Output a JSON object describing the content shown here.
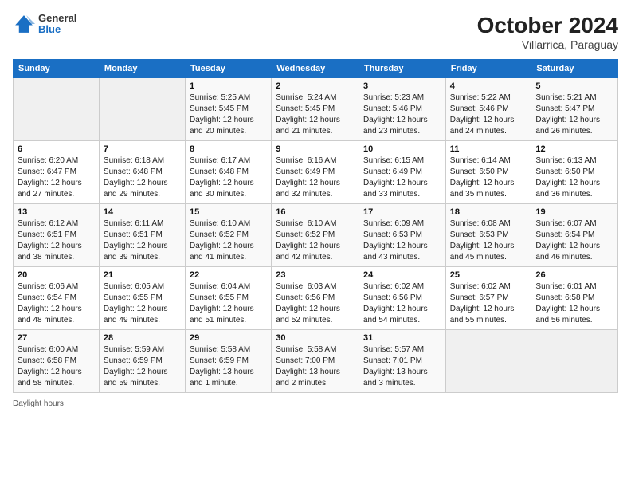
{
  "header": {
    "logo_general": "General",
    "logo_blue": "Blue",
    "month_year": "October 2024",
    "location": "Villarrica, Paraguay"
  },
  "days_of_week": [
    "Sunday",
    "Monday",
    "Tuesday",
    "Wednesday",
    "Thursday",
    "Friday",
    "Saturday"
  ],
  "weeks": [
    [
      {
        "day": "",
        "info": ""
      },
      {
        "day": "",
        "info": ""
      },
      {
        "day": "1",
        "info": "Sunrise: 5:25 AM\nSunset: 5:45 PM\nDaylight: 12 hours and 20 minutes."
      },
      {
        "day": "2",
        "info": "Sunrise: 5:24 AM\nSunset: 5:45 PM\nDaylight: 12 hours and 21 minutes."
      },
      {
        "day": "3",
        "info": "Sunrise: 5:23 AM\nSunset: 5:46 PM\nDaylight: 12 hours and 23 minutes."
      },
      {
        "day": "4",
        "info": "Sunrise: 5:22 AM\nSunset: 5:46 PM\nDaylight: 12 hours and 24 minutes."
      },
      {
        "day": "5",
        "info": "Sunrise: 5:21 AM\nSunset: 5:47 PM\nDaylight: 12 hours and 26 minutes."
      }
    ],
    [
      {
        "day": "6",
        "info": "Sunrise: 6:20 AM\nSunset: 6:47 PM\nDaylight: 12 hours and 27 minutes."
      },
      {
        "day": "7",
        "info": "Sunrise: 6:18 AM\nSunset: 6:48 PM\nDaylight: 12 hours and 29 minutes."
      },
      {
        "day": "8",
        "info": "Sunrise: 6:17 AM\nSunset: 6:48 PM\nDaylight: 12 hours and 30 minutes."
      },
      {
        "day": "9",
        "info": "Sunrise: 6:16 AM\nSunset: 6:49 PM\nDaylight: 12 hours and 32 minutes."
      },
      {
        "day": "10",
        "info": "Sunrise: 6:15 AM\nSunset: 6:49 PM\nDaylight: 12 hours and 33 minutes."
      },
      {
        "day": "11",
        "info": "Sunrise: 6:14 AM\nSunset: 6:50 PM\nDaylight: 12 hours and 35 minutes."
      },
      {
        "day": "12",
        "info": "Sunrise: 6:13 AM\nSunset: 6:50 PM\nDaylight: 12 hours and 36 minutes."
      }
    ],
    [
      {
        "day": "13",
        "info": "Sunrise: 6:12 AM\nSunset: 6:51 PM\nDaylight: 12 hours and 38 minutes."
      },
      {
        "day": "14",
        "info": "Sunrise: 6:11 AM\nSunset: 6:51 PM\nDaylight: 12 hours and 39 minutes."
      },
      {
        "day": "15",
        "info": "Sunrise: 6:10 AM\nSunset: 6:52 PM\nDaylight: 12 hours and 41 minutes."
      },
      {
        "day": "16",
        "info": "Sunrise: 6:10 AM\nSunset: 6:52 PM\nDaylight: 12 hours and 42 minutes."
      },
      {
        "day": "17",
        "info": "Sunrise: 6:09 AM\nSunset: 6:53 PM\nDaylight: 12 hours and 43 minutes."
      },
      {
        "day": "18",
        "info": "Sunrise: 6:08 AM\nSunset: 6:53 PM\nDaylight: 12 hours and 45 minutes."
      },
      {
        "day": "19",
        "info": "Sunrise: 6:07 AM\nSunset: 6:54 PM\nDaylight: 12 hours and 46 minutes."
      }
    ],
    [
      {
        "day": "20",
        "info": "Sunrise: 6:06 AM\nSunset: 6:54 PM\nDaylight: 12 hours and 48 minutes."
      },
      {
        "day": "21",
        "info": "Sunrise: 6:05 AM\nSunset: 6:55 PM\nDaylight: 12 hours and 49 minutes."
      },
      {
        "day": "22",
        "info": "Sunrise: 6:04 AM\nSunset: 6:55 PM\nDaylight: 12 hours and 51 minutes."
      },
      {
        "day": "23",
        "info": "Sunrise: 6:03 AM\nSunset: 6:56 PM\nDaylight: 12 hours and 52 minutes."
      },
      {
        "day": "24",
        "info": "Sunrise: 6:02 AM\nSunset: 6:56 PM\nDaylight: 12 hours and 54 minutes."
      },
      {
        "day": "25",
        "info": "Sunrise: 6:02 AM\nSunset: 6:57 PM\nDaylight: 12 hours and 55 minutes."
      },
      {
        "day": "26",
        "info": "Sunrise: 6:01 AM\nSunset: 6:58 PM\nDaylight: 12 hours and 56 minutes."
      }
    ],
    [
      {
        "day": "27",
        "info": "Sunrise: 6:00 AM\nSunset: 6:58 PM\nDaylight: 12 hours and 58 minutes."
      },
      {
        "day": "28",
        "info": "Sunrise: 5:59 AM\nSunset: 6:59 PM\nDaylight: 12 hours and 59 minutes."
      },
      {
        "day": "29",
        "info": "Sunrise: 5:58 AM\nSunset: 6:59 PM\nDaylight: 13 hours and 1 minute."
      },
      {
        "day": "30",
        "info": "Sunrise: 5:58 AM\nSunset: 7:00 PM\nDaylight: 13 hours and 2 minutes."
      },
      {
        "day": "31",
        "info": "Sunrise: 5:57 AM\nSunset: 7:01 PM\nDaylight: 13 hours and 3 minutes."
      },
      {
        "day": "",
        "info": ""
      },
      {
        "day": "",
        "info": ""
      }
    ]
  ],
  "footer": {
    "daylight_label": "Daylight hours"
  }
}
